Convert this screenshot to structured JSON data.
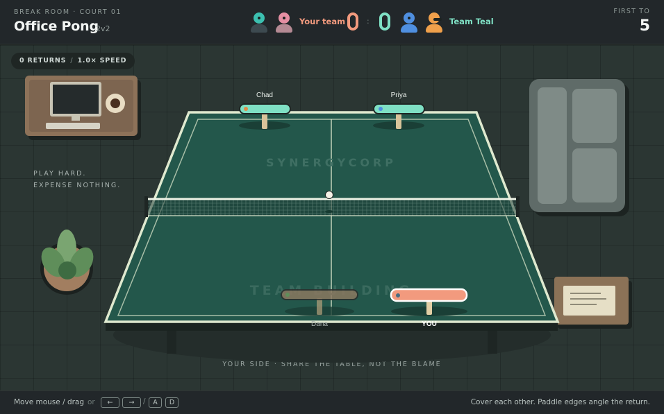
{
  "header": {
    "venue": "BREAK ROOM · COURT 01",
    "title": "Office Pong",
    "mode": "2v2",
    "first_to_label": "FIRST TO",
    "first_to_value": "5"
  },
  "scoreboard": {
    "home": {
      "label": "Your team",
      "score": 0,
      "color": "#f29a7e"
    },
    "away": {
      "label": "Team Teal",
      "score": 0,
      "color": "#7fe0c4"
    },
    "separator": ":"
  },
  "hud": {
    "returns": "0 RETURNS",
    "speed": "1.0× SPEED"
  },
  "room": {
    "slogan_line1": "PLAY HARD.",
    "slogan_line2": "EXPENSE NOTHING.",
    "caption": "YOUR SIDE · SHARE THE TABLE, NOT THE BLAME"
  },
  "table": {
    "far_brand": "SYNERGYCORP",
    "near_brand": "TEAM BUILDING",
    "surface_color": "#23574b",
    "line_color": "#dfe9cf"
  },
  "players": {
    "chad": {
      "name": "Chad",
      "color": "#7fe0c4"
    },
    "priya": {
      "name": "Priya",
      "color": "#7fe0c4"
    },
    "dana": {
      "name": "Dana",
      "color": "#8a7860"
    },
    "you": {
      "name": "YOU",
      "color": "#f29a7e"
    }
  },
  "footer": {
    "hint": "Move mouse / drag",
    "or": "or",
    "keys": [
      "←",
      "→",
      "A",
      "D"
    ],
    "tip": "Cover each other. Paddle edges angle the return."
  }
}
